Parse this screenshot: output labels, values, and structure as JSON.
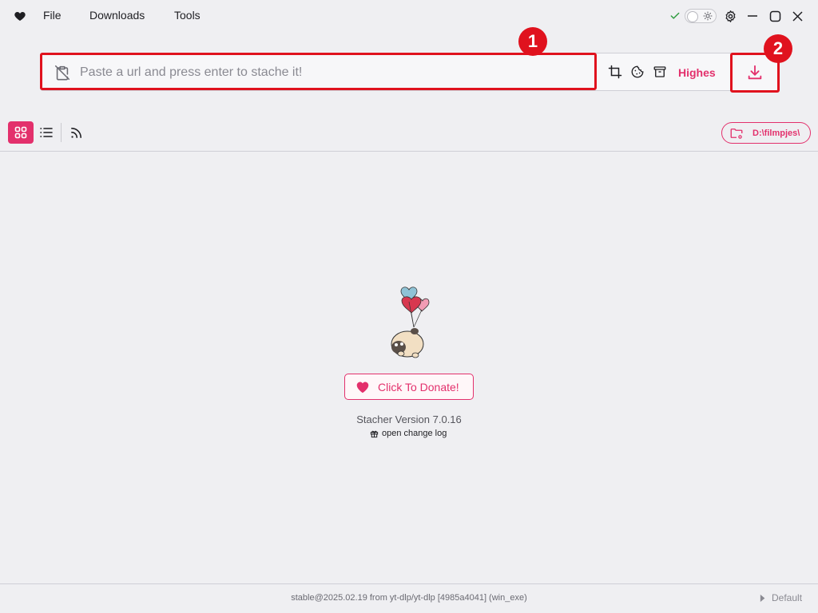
{
  "menu": {
    "file": "File",
    "downloads": "Downloads",
    "tools": "Tools"
  },
  "icons": {
    "app": "heart-icon",
    "status": "check-icon",
    "theme": "sun-icon",
    "settings": "gear-icon",
    "minimize": "minimize-icon",
    "maximize": "maximize-icon",
    "close": "close-icon",
    "clipboard": "clipboard-off-icon",
    "crop": "crop-icon",
    "cookie": "cookie-icon",
    "archive": "archive-icon",
    "download": "download-icon",
    "grid_view": "grid-icon",
    "list_view": "list-icon",
    "rss": "rss-icon",
    "folder": "folder-settings-icon",
    "gift": "gift-icon",
    "chevron": "chevron-right-icon"
  },
  "url_bar": {
    "placeholder": "Paste a url and press enter to stache it!",
    "value": "",
    "quality": "Highes"
  },
  "annotations": {
    "badge1": "1",
    "badge2": "2"
  },
  "folder": {
    "path": "D:\\filmpjes\\"
  },
  "center": {
    "donate": "Click To Donate!",
    "version": "Stacher Version 7.0.16",
    "changelog": "open change log"
  },
  "footer": {
    "build": "stable@2025.02.19 from yt-dlp/yt-dlp [4985a4041] (win_exe)",
    "profile": "Default"
  },
  "colors": {
    "accent": "#e3306c",
    "annotation_red": "#e0121e",
    "background": "#efeff2",
    "status_green": "#2e9c3f"
  }
}
